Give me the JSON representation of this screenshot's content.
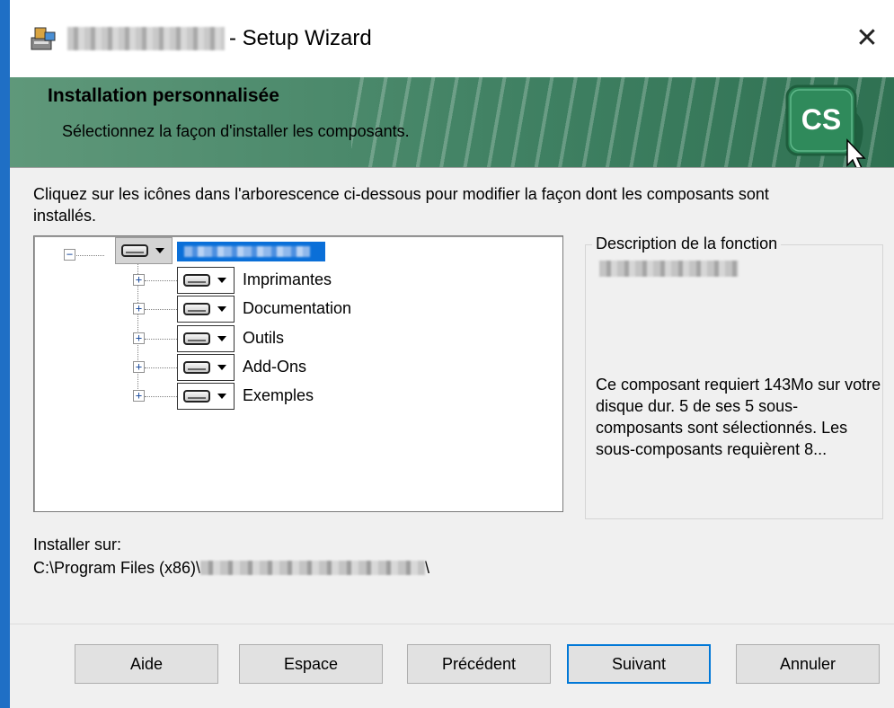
{
  "window": {
    "title_suffix": "- Setup Wizard",
    "close_symbol": "✕",
    "app_icon": "installer-icon"
  },
  "banner": {
    "title": "Installation personnalisée",
    "subtitle": "Sélectionnez la façon d'installer les composants.",
    "logo_text": "CS"
  },
  "instructions": "Cliquez sur les icônes dans l'arborescence ci-dessous pour modifier la façon dont les composants sont installés.",
  "tree": {
    "children": [
      {
        "label": "Imprimantes"
      },
      {
        "label": "Documentation"
      },
      {
        "label": "Outils"
      },
      {
        "label": "Add-Ons"
      },
      {
        "label": "Exemples"
      }
    ]
  },
  "description": {
    "legend": "Description de la fonction",
    "text": "Ce composant requiert 143Mo sur votre disque dur. 5 de ses 5 sous-composants sont sélectionnés. Les sous-composants requièrent 8..."
  },
  "install": {
    "label": "Installer sur:",
    "path_prefix": "C:\\Program Files (x86)\\",
    "path_suffix": "\\"
  },
  "buttons": {
    "help": "Aide",
    "space": "Espace",
    "previous": "Précédent",
    "next": "Suivant",
    "cancel": "Annuler"
  },
  "colors": {
    "accent": "#0078d7",
    "banner_green": "#3f8062",
    "selection_blue": "#0a6fd8",
    "logo_green": "#2f8a5b"
  }
}
